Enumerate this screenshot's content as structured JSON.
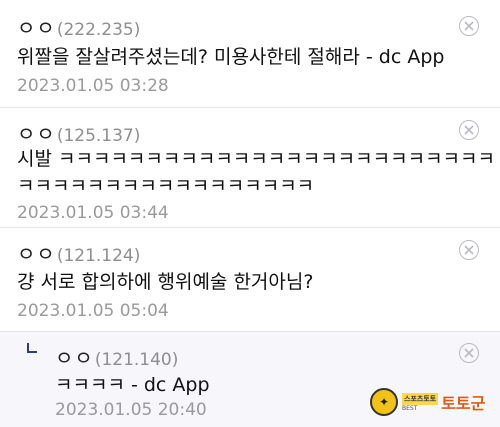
{
  "comments": [
    {
      "nickname": "ㅇㅇ",
      "ip": "(222.235)",
      "lines": [
        "위짤을 잘살려주셨는데? 미용사한테 절해라 - dc App"
      ],
      "date": "2023.01.05 03:28"
    },
    {
      "nickname": "ㅇㅇ",
      "ip": "(125.137)",
      "lines": [
        "시발 ㅋㅋㅋㅋㅋㅋㅋㅋㅋㅋㅋㅋㅋㅋㅋㅋㅋㅋㅋㅋㅋㅋㅋㅋㅋ",
        "ㅋㅋㅋㅋㅋㅋㅋㅋㅋㅋㅋㅋㅋㅋㅋㅋㅋ"
      ],
      "date": "2023.01.05 03:44"
    },
    {
      "nickname": "ㅇㅇ",
      "ip": "(121.124)",
      "lines": [
        "걍 서로 합의하에 행위예술 한거아님?"
      ],
      "date": "2023.01.05 05:04"
    },
    {
      "nickname": "ㅇㅇ",
      "ip": "(121.140)",
      "lines": [
        "ㅋㅋㅋㅋ - dc App"
      ],
      "date": "2023.01.05 20:40",
      "is_reply": true
    }
  ],
  "icons": {
    "delete": "close-circle-icon",
    "reply": "reply-arrow-icon"
  },
  "watermark": {
    "top": "스포츠토토",
    "bottom": "BEST",
    "big": "토토군"
  },
  "colors": {
    "reply_background": "#f6f6fb",
    "reply_marker": "#2d3a86",
    "meta_gray": "#9a9a9a"
  }
}
